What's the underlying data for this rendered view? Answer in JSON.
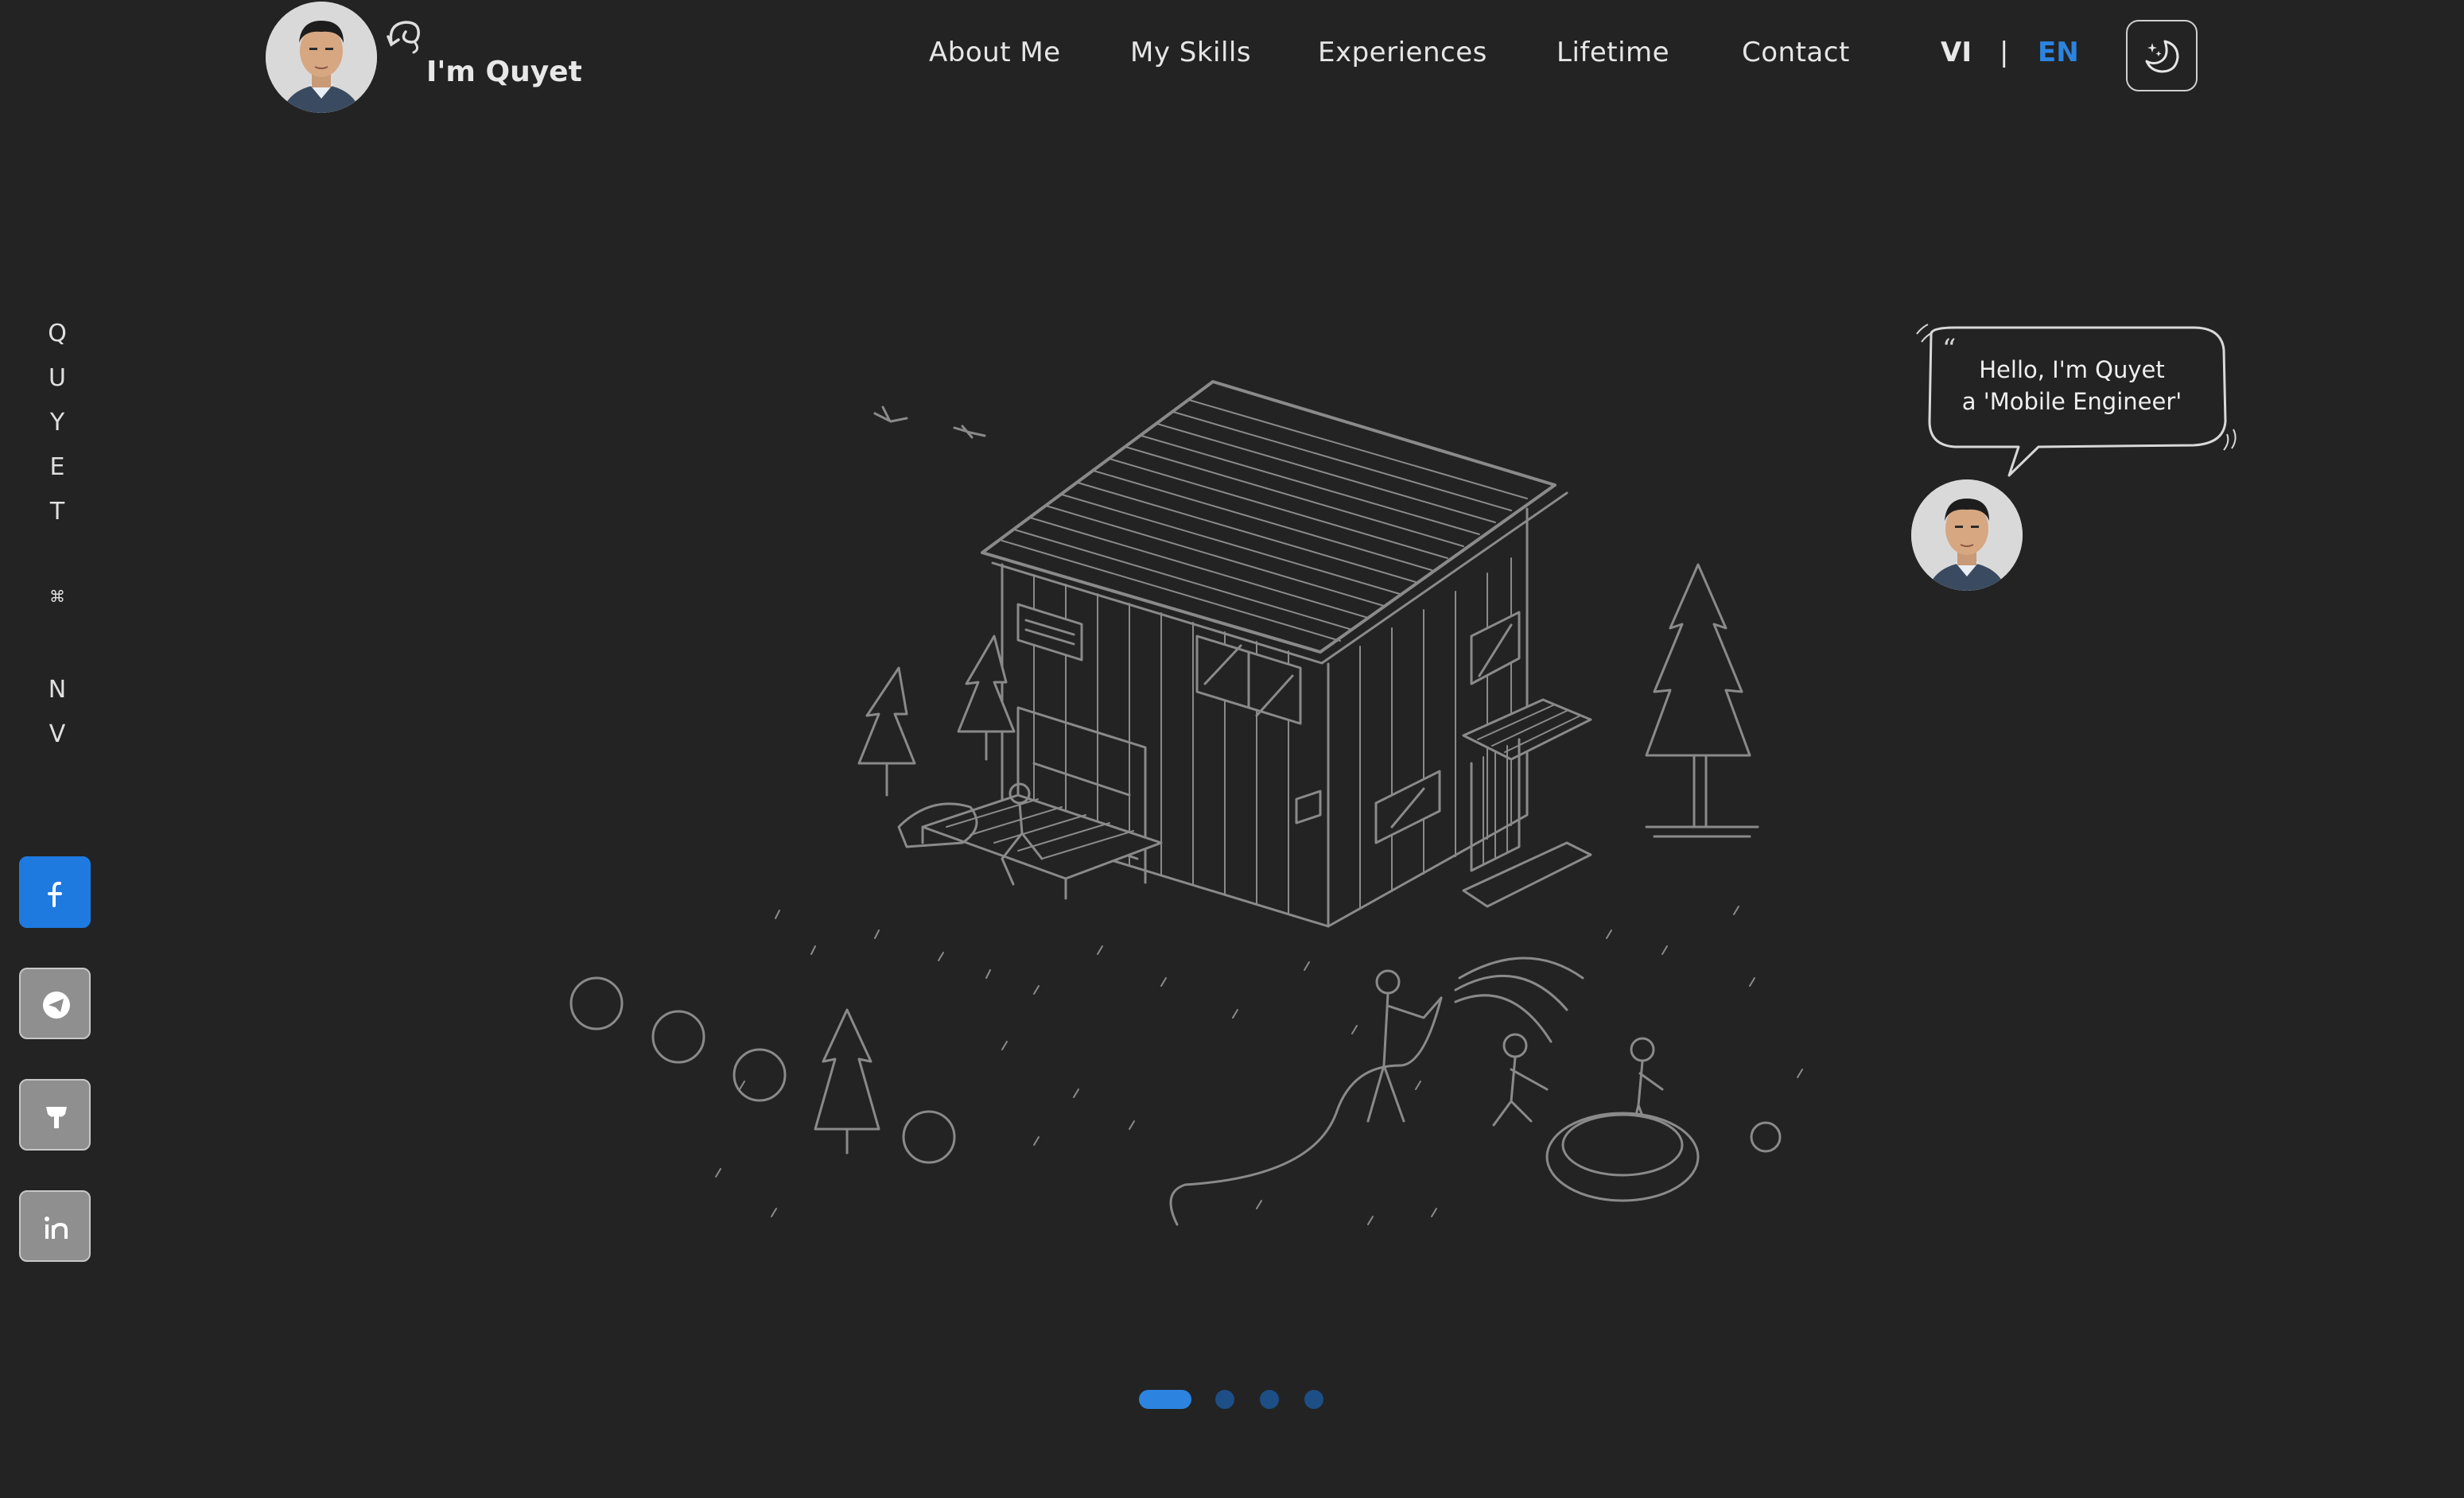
{
  "header": {
    "brand": "I'm Quyet",
    "nav": [
      "About Me",
      "My Skills",
      "Experiences",
      "Lifetime",
      "Contact"
    ],
    "lang_vi": "VI",
    "lang_sep": "|",
    "lang_en": "EN",
    "theme_icon": "moon-stars-icon"
  },
  "sidebar": {
    "letters": [
      "Q",
      "U",
      "Y",
      "E",
      "T",
      "⌘",
      "N",
      "V"
    ],
    "social": [
      {
        "name": "facebook",
        "icon": "facebook-icon",
        "active": true
      },
      {
        "name": "telegram",
        "icon": "telegram-icon",
        "active": false
      },
      {
        "name": "blog",
        "icon": "blog-icon",
        "active": false
      },
      {
        "name": "linkedin",
        "icon": "linkedin-icon",
        "active": false
      }
    ]
  },
  "hero": {
    "bubble_line1": "Hello, I'm Quyet",
    "bubble_line2": "a 'Mobile Engineer'",
    "illustration": "isometric-house-illustration"
  },
  "carousel": {
    "count": 4,
    "active_index": 0
  },
  "colors": {
    "background": "#232323",
    "accent": "#2c84e0",
    "line_art": "#8a8a8a",
    "dot_inactive": "#1d4f86"
  }
}
